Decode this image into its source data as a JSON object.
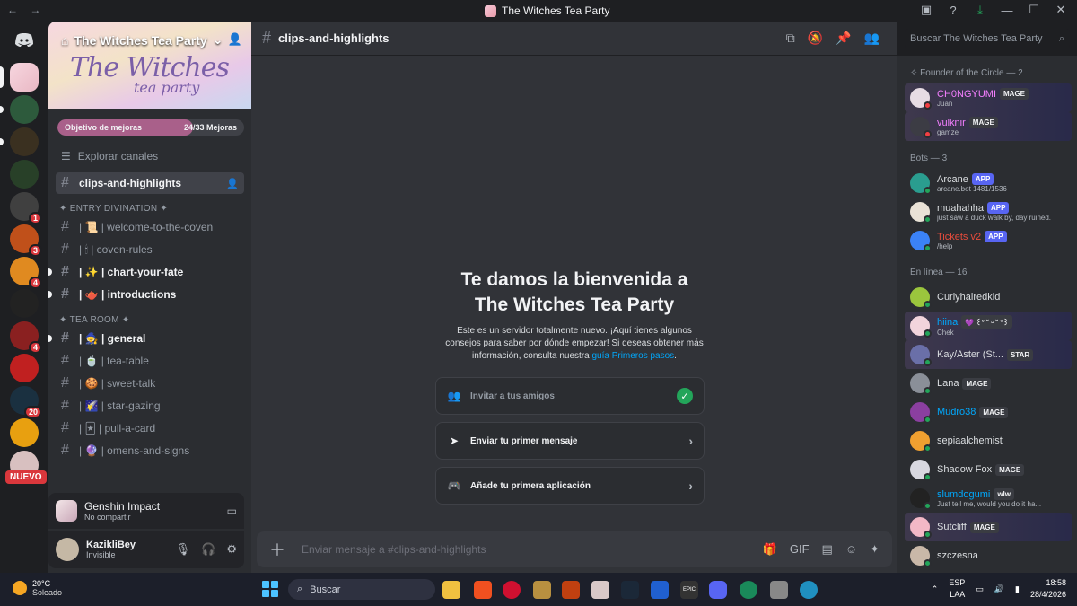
{
  "window": {
    "title": "The Witches Tea Party",
    "back_icon": "arrow-left-icon",
    "forward_icon": "arrow-right-icon"
  },
  "server": {
    "name": "The Witches Tea Party",
    "banner_art_line1": "The Witches",
    "banner_art_line2": "tea party",
    "boost_label": "Objetivo de mejoras",
    "boost_count": "24/33 Mejoras",
    "boost_progress": 0.727,
    "explore_label": "Explorar canales"
  },
  "guild_badges": [
    "1",
    "3",
    "4",
    "4",
    "20"
  ],
  "nuevo_label": "NUEVO",
  "channels": {
    "active": "clips-and-highlights",
    "categories": [
      {
        "label": "✦ ENTRY DIVINATION ✦",
        "items": [
          {
            "name": "| 📜 | welcome-to-the-coven",
            "unread": false
          },
          {
            "name": "| 🕯 | coven-rules",
            "unread": false
          },
          {
            "name": "| ✨ | chart-your-fate",
            "unread": true
          },
          {
            "name": "| 🫖 | introductions",
            "unread": true
          }
        ]
      },
      {
        "label": "✦ TEA ROOM ✦",
        "items": [
          {
            "name": "| 🧙 | general",
            "unread": true
          },
          {
            "name": "| 🍵 | tea-table",
            "unread": false
          },
          {
            "name": "| 🍪 | sweet-talk",
            "unread": false
          },
          {
            "name": "| 🌠 | star-gazing",
            "unread": false
          },
          {
            "name": "| 🃏 | pull-a-card",
            "unread": false
          },
          {
            "name": "| 🔮 | omens-and-signs",
            "unread": false
          }
        ]
      }
    ]
  },
  "activity": {
    "game": "Genshin Impact",
    "sub": "No compartir"
  },
  "user": {
    "name": "KazikliBey",
    "status": "Invisible"
  },
  "header": {
    "channel": "clips-and-highlights",
    "search_placeholder": "Buscar The Witches Tea Party"
  },
  "welcome": {
    "title_line1": "Te damos la bienvenida a",
    "title_line2": "The Witches Tea Party",
    "body": "Este es un servidor totalmente nuevo. ¡Aquí tienes algunos consejos para saber por dónde empezar! Si deseas obtener más información, consulta nuestra",
    "link": "guía Primeros pasos",
    "tasks": [
      {
        "label": "Invitar a tus amigos",
        "done": true
      },
      {
        "label": "Enviar tu primer mensaje",
        "done": false
      },
      {
        "label": "Añade tu primera aplicación",
        "done": false
      }
    ]
  },
  "composer": {
    "placeholder": "Enviar mensaje a #clips-and-highlights"
  },
  "members": {
    "groups": [
      {
        "label": "✧ Founder of the Circle — 2",
        "items": [
          {
            "name": "CH0NGYUMI",
            "tag": "MAGE",
            "sub": "Juan",
            "color": "#f47fff",
            "avatar": "#e7dce4",
            "status": "#f23f43",
            "deco": true
          },
          {
            "name": "vulknir",
            "tag": "MAGE",
            "sub": "gamze",
            "color": "#f47fff",
            "avatar": "#3c3c44",
            "status": "#f23f43",
            "deco": true
          }
        ]
      },
      {
        "label": "Bots — 3",
        "items": [
          {
            "name": "Arcane",
            "tag": "APP",
            "sub": "arcane.bot 1481/1536",
            "color": "#dbdee1",
            "avatar": "#2a9d8f",
            "status": "#23a55a",
            "deco": false
          },
          {
            "name": "muahahha",
            "tag": "APP",
            "sub": "just saw a duck walk by, day ruined.",
            "color": "#dbdee1",
            "avatar": "#e9e2d6",
            "status": "#23a55a",
            "deco": false
          },
          {
            "name": "Tickets v2",
            "tag": "APP",
            "sub": "/help",
            "color": "#e74c3c",
            "avatar": "#3b82f6",
            "status": "#23a55a",
            "deco": false
          }
        ]
      },
      {
        "label": "En línea — 16",
        "items": [
          {
            "name": "Curlyhairedkid",
            "tag": "",
            "sub": "",
            "color": "#dbdee1",
            "avatar": "#9bc53d",
            "status": "#23a55a",
            "deco": false
          },
          {
            "name": "hiina",
            "tag": "💜 ꒰ᐡ ˘ ᵕ ˘ ᐡ꒱",
            "sub": "Chek",
            "color": "#00a8fc",
            "avatar": "#f2d4dc",
            "status": "#23a55a",
            "deco": true
          },
          {
            "name": "Kay/Aster (St...",
            "tag": "STAR",
            "sub": "",
            "color": "#dbdee1",
            "avatar": "#6a6fa8",
            "status": "#23a55a",
            "deco": true
          },
          {
            "name": "Lana",
            "tag": "MAGE",
            "sub": "",
            "color": "#dbdee1",
            "avatar": "#8a8f98",
            "status": "#23a55a",
            "deco": false
          },
          {
            "name": "Mudro38",
            "tag": "MAGE",
            "sub": "",
            "color": "#00a8fc",
            "avatar": "#8b3fa0",
            "status": "#23a55a",
            "deco": false
          },
          {
            "name": "sepiaalchemist",
            "tag": "",
            "sub": "",
            "color": "#dbdee1",
            "avatar": "#f0a030",
            "status": "#23a55a",
            "deco": false
          },
          {
            "name": "Shadow Fox",
            "tag": "MAGE",
            "sub": "",
            "color": "#dbdee1",
            "avatar": "#d8d8e0",
            "status": "#23a55a",
            "deco": false
          },
          {
            "name": "slumdogumi",
            "tag": "wlw",
            "sub": "Just tell me, would you do it ha...",
            "color": "#00a8fc",
            "avatar": "#222",
            "status": "#23a55a",
            "deco": false
          },
          {
            "name": "Sutcliff",
            "tag": "MAGE",
            "sub": "",
            "color": "#dbdee1",
            "avatar": "#f2b8c6",
            "status": "#23a55a",
            "deco": true
          },
          {
            "name": "szczesna",
            "tag": "",
            "sub": "",
            "color": "#dbdee1",
            "avatar": "#c9b8a8",
            "status": "#23a55a",
            "deco": false
          }
        ]
      }
    ]
  },
  "taskbar": {
    "temp": "20°C",
    "weather": "Soleado",
    "search": "Buscar",
    "lang1": "ESP",
    "lang2": "LAA",
    "time": "18:58",
    "date": "28/4/2026"
  }
}
